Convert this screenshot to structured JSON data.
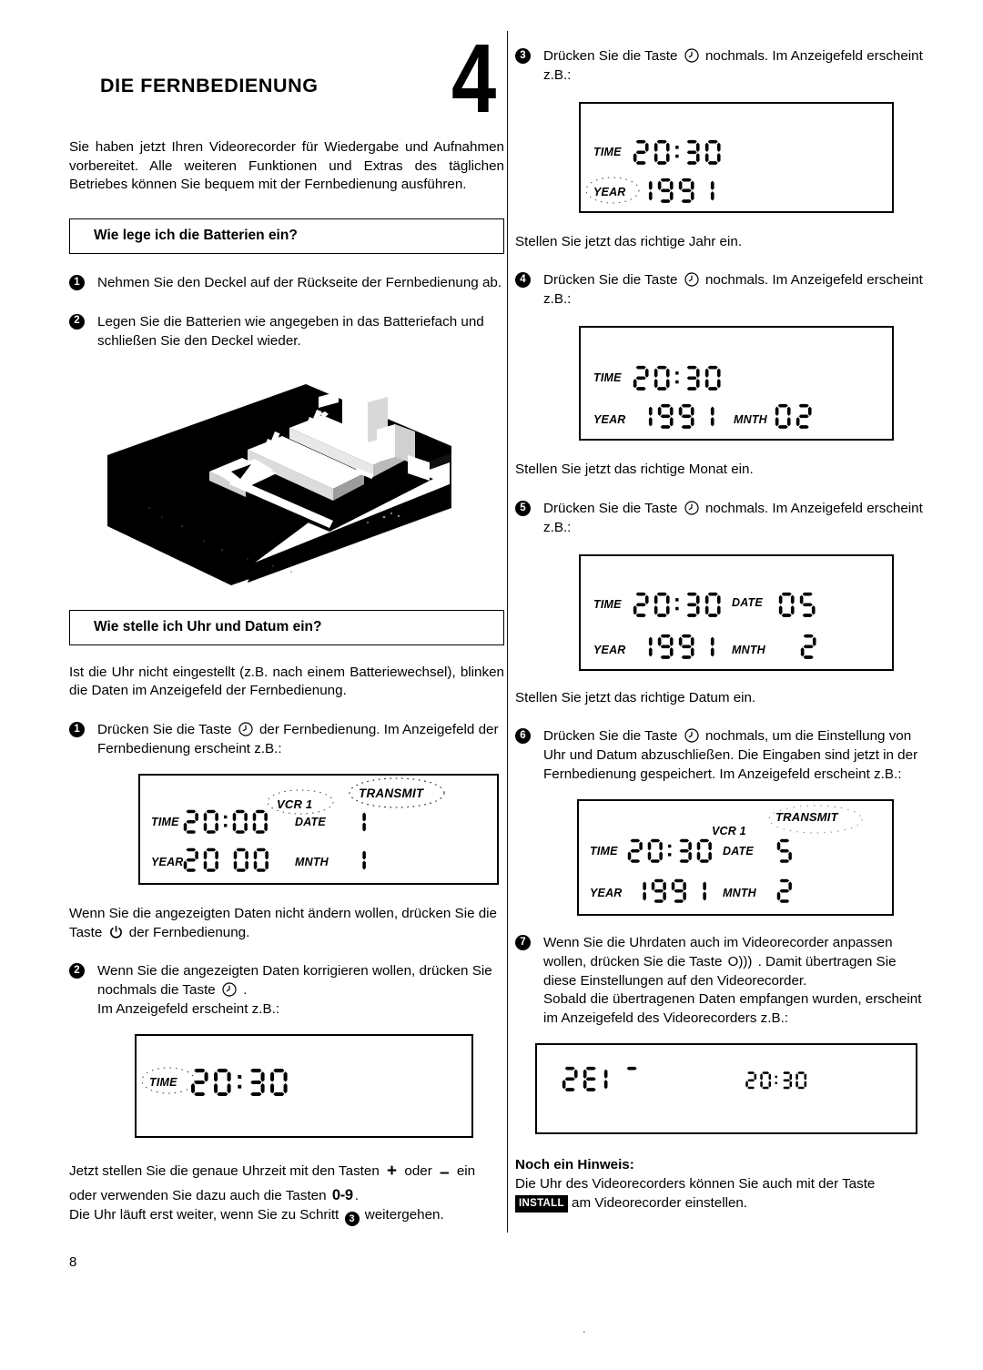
{
  "document": {
    "page_number": "8",
    "chapter_number": "4",
    "chapter_title": "DIE FERNBEDIENUNG"
  },
  "left": {
    "intro": "Sie haben jetzt Ihren Videorecorder für Wiedergabe und Aufnahmen vorbereitet. Alle weiteren Funktionen und Extras des täglichen Betriebes können Sie bequem mit der Fernbedienung ausführen.",
    "section_batteries": "Wie lege ich die Batterien ein?",
    "step1_num": "1",
    "step1_text": "Nehmen Sie den Deckel auf der Rückseite der Fernbedienung ab.",
    "step2_num": "2",
    "step2_text": "Legen Sie die Batterien wie angegeben in das Batteriefach und schließen Sie den Deckel wieder.",
    "photo_alt": "Fernbedienung Batteriefach",
    "section_clock": "Wie stelle ich Uhr und Datum ein?",
    "clock_intro": "Ist die Uhr nicht eingestellt (z.B. nach einem Batteriewechsel), blinken die Daten im Anzeigefeld der Fernbedienung.",
    "step1b_num": "1",
    "step1b_a": "Drücken Sie die Taste",
    "step1b_b": "der Fernbedienung. Im Anzeigefeld der Fernbedienung erscheint z.B.:",
    "after_display1_a": "Wenn Sie die angezeigten Daten nicht ändern wollen, drücken Sie die Taste",
    "after_display1_b": "der Fernbedienung.",
    "step2b_num": "2",
    "step2b_a": "Wenn Sie die angezeigten Daten korrigieren wollen, drücken Sie nochmals die Taste",
    "step2b_b": ".",
    "step2b_c": "Im Anzeigefeld erscheint z.B.:",
    "footer_a": "Jetzt stellen Sie die genaue Uhrzeit mit den Tasten",
    "footer_plus": "+",
    "footer_oder": "oder",
    "footer_minus": "–",
    "footer_b": "ein oder verwenden Sie dazu auch die Tasten",
    "footer_keys": "0-9",
    "footer_c": ".",
    "footer_d": "Die Uhr läuft erst weiter, wenn Sie zu Schritt",
    "footer_step": "3",
    "footer_e": "weitergehen."
  },
  "right": {
    "step3_num": "3",
    "step3_a": "Drücken Sie die Taste",
    "step3_b": "nochmals. Im Anzeigefeld erscheint z.B.:",
    "after3": "Stellen Sie jetzt das richtige Jahr ein.",
    "step4_num": "4",
    "step4_a": "Drücken Sie die Taste",
    "step4_b": "nochmals. Im Anzeigefeld erscheint z.B.:",
    "after4": "Stellen Sie jetzt das richtige Monat ein.",
    "step5_num": "5",
    "step5_a": "Drücken Sie die Taste",
    "step5_b": "nochmals. Im Anzeigefeld erscheint z.B.:",
    "after5": "Stellen Sie jetzt das richtige Datum ein.",
    "step6_num": "6",
    "step6_a": "Drücken Sie die Taste",
    "step6_b": "nochmals, um die Einstellung von Uhr und Datum abzuschließen. Die Eingaben sind jetzt in der Fernbedienung gespeichert. Im Anzeigefeld erscheint z.B.:",
    "step7_num": "7",
    "step7_a": "Wenn Sie die Uhrdaten auch im Videorecorder anpassen wollen, drücken Sie die Taste",
    "step7_transmit": "O)))",
    "step7_b": ". Damit übertragen Sie diese Einstellungen auf den Videorecorder.",
    "step7_c": "Sobald die übertragenen Daten empfangen wurden, erscheint im  Anzeigefeld des Videorecorders z.B.:",
    "note_title": "Noch ein Hinweis:",
    "note_a": "Die Uhr des Videorecorders können Sie auch mit der Taste",
    "note_install": "INSTALL",
    "note_b": "am Videorecorder einstellen."
  },
  "displays": {
    "d1": {
      "name": "remote-display-initial",
      "labels": {
        "time": "TIME",
        "date": "DATE",
        "year": "YEAR",
        "mnth": "MNTH",
        "vcr": "VCR 1",
        "transmit": "TRANSMIT"
      },
      "time": "20:00",
      "date": "1",
      "year": "20 00",
      "mnth": "1",
      "blinking": [
        "VCR 1",
        "TRANSMIT"
      ]
    },
    "d2": {
      "name": "remote-display-time-set",
      "labels": {
        "time": "TIME"
      },
      "time": "20:30",
      "blinking": [
        "TIME"
      ]
    },
    "d3": {
      "name": "remote-display-year",
      "labels": {
        "time": "TIME",
        "year": "YEAR"
      },
      "time": "20:30",
      "year": "1991",
      "blinking": [
        "YEAR"
      ]
    },
    "d4": {
      "name": "remote-display-month",
      "labels": {
        "time": "TIME",
        "year": "YEAR",
        "mnth": "MNTH"
      },
      "time": "20:30",
      "year": "1991",
      "mnth": "02",
      "blinking": []
    },
    "d5": {
      "name": "remote-display-date",
      "labels": {
        "time": "TIME",
        "date": "DATE",
        "year": "YEAR",
        "mnth": "MNTH"
      },
      "time": "20:30",
      "date": "05",
      "year": "1991",
      "mnth": "2",
      "blinking": []
    },
    "d6": {
      "name": "remote-display-complete",
      "labels": {
        "time": "TIME",
        "date": "DATE",
        "year": "YEAR",
        "mnth": "MNTH",
        "vcr": "VCR 1",
        "transmit": "TRANSMIT"
      },
      "time": "20:30",
      "date": "5",
      "year": "1991",
      "mnth": "2",
      "blinking": [
        "TRANSMIT"
      ]
    },
    "d7": {
      "name": "vcr-display-zeit",
      "text": "ZEIT",
      "time": "20:30"
    }
  }
}
